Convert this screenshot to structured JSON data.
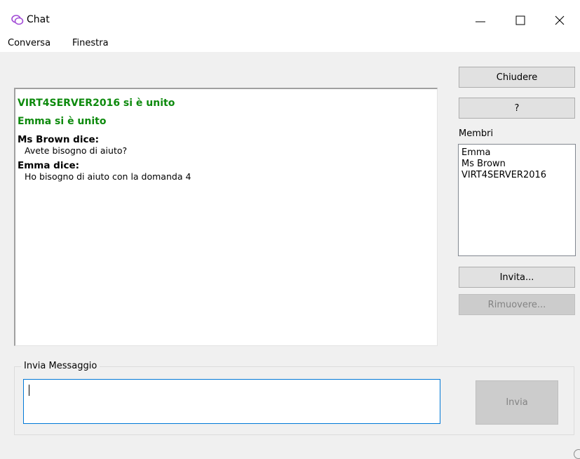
{
  "window": {
    "title": "Chat",
    "minimize_icon": "minimize-icon",
    "maximize_icon": "maximize-icon",
    "close_icon": "close-icon"
  },
  "menu": {
    "items": [
      "Conversa",
      "Finestra"
    ]
  },
  "chat": {
    "joins": [
      "VIRT4SERVER2016 si è unito",
      "Emma si è unito"
    ],
    "messages": [
      {
        "speaker": "Ms Brown dice:",
        "text": "Avete bisogno di aiuto?"
      },
      {
        "speaker": "Emma dice:",
        "text": "Ho bisogno di aiuto con la domanda 4"
      }
    ]
  },
  "side": {
    "close_label": "Chiudere",
    "help_label": "?",
    "members_label": "Membri",
    "members": [
      "Emma",
      "Ms Brown",
      "VIRT4SERVER2016"
    ],
    "invite_label": "Invita...",
    "remove_label": "Rimuovere..."
  },
  "compose": {
    "group_label": "Invia Messaggio",
    "input_value": "",
    "send_label": "Invia"
  },
  "colors": {
    "join_text": "#0d8a0d",
    "input_focus": "#0078d7",
    "app_icon": "#a24bd6"
  }
}
